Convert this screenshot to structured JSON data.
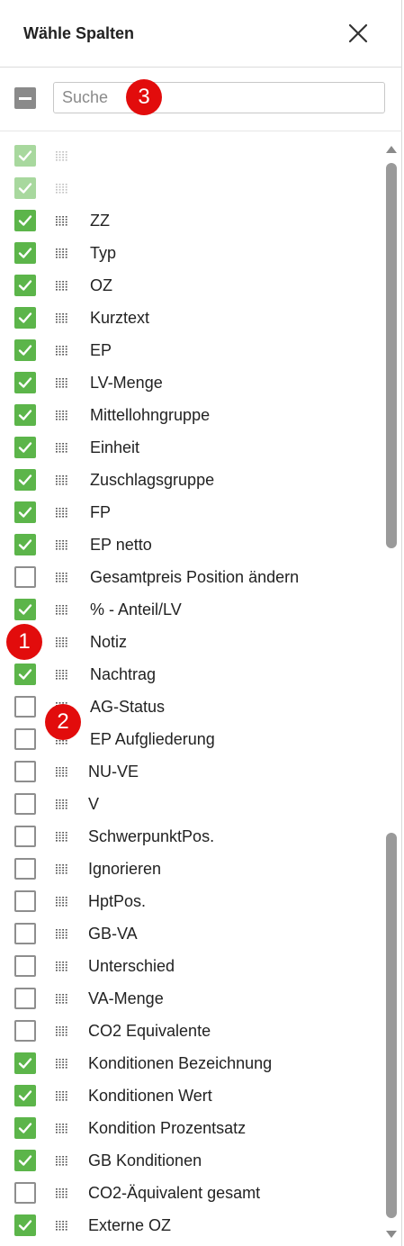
{
  "header": {
    "title": "Wähle Spalten"
  },
  "search": {
    "placeholder": "Suche"
  },
  "rows": [
    {
      "label": "",
      "state": "faded"
    },
    {
      "label": "",
      "state": "faded"
    },
    {
      "label": "ZZ",
      "state": "on"
    },
    {
      "label": "Typ",
      "state": "on"
    },
    {
      "label": "OZ",
      "state": "on"
    },
    {
      "label": "Kurztext",
      "state": "on"
    },
    {
      "label": "EP",
      "state": "on"
    },
    {
      "label": "LV-Menge",
      "state": "on"
    },
    {
      "label": "Mittellohngruppe",
      "state": "on"
    },
    {
      "label": "Einheit",
      "state": "on"
    },
    {
      "label": "Zuschlagsgruppe",
      "state": "on"
    },
    {
      "label": "FP",
      "state": "on"
    },
    {
      "label": "EP netto",
      "state": "on"
    },
    {
      "label": "Gesamtpreis Position ändern",
      "state": "off"
    },
    {
      "label": "% - Anteil/LV",
      "state": "on"
    },
    {
      "label": "Notiz",
      "state": "on"
    },
    {
      "label": "Nachtrag",
      "state": "on"
    },
    {
      "label": "AG-Status",
      "state": "off"
    },
    {
      "label": "EP Aufgliederung",
      "state": "off"
    },
    {
      "label": "NU-VE",
      "state": "off"
    },
    {
      "label": "V",
      "state": "off"
    },
    {
      "label": "SchwerpunktPos.",
      "state": "off"
    },
    {
      "label": "Ignorieren",
      "state": "off"
    },
    {
      "label": "HptPos.",
      "state": "off"
    },
    {
      "label": "GB-VA",
      "state": "off"
    },
    {
      "label": "Unterschied",
      "state": "off"
    },
    {
      "label": "VA-Menge",
      "state": "off"
    },
    {
      "label": "CO2 Equivalente",
      "state": "off"
    },
    {
      "label": "Konditionen Bezeichnung",
      "state": "on"
    },
    {
      "label": "Konditionen Wert",
      "state": "on"
    },
    {
      "label": "Kondition Prozentsatz",
      "state": "on"
    },
    {
      "label": "GB Konditionen",
      "state": "on"
    },
    {
      "label": "CO2-Äquivalent gesamt",
      "state": "off"
    },
    {
      "label": "Externe OZ",
      "state": "on"
    }
  ],
  "badges": [
    "1",
    "2",
    "3"
  ],
  "colors": {
    "checked": "#5cb54a",
    "checked_faded": "#a8d89e",
    "badge": "#e20c0c"
  }
}
